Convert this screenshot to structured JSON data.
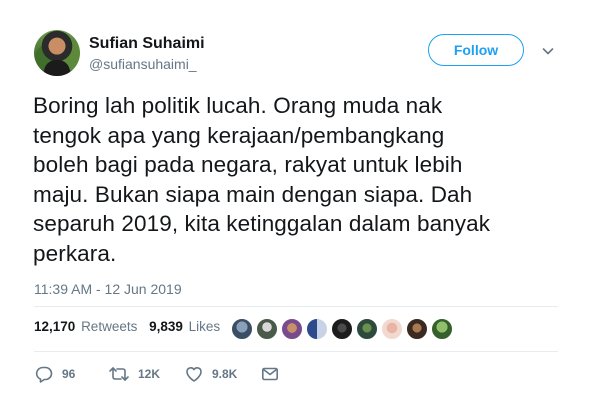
{
  "user": {
    "name": "Sufian Suhaimi",
    "handle": "@sufiansuhaimi_",
    "follow_label": "Follow"
  },
  "tweet": {
    "lines": [
      "Boring lah politik lucah. Orang muda nak",
      "tengok apa yang kerajaan/pembangkang",
      "boleh bagi pada negara, rakyat untuk lebih",
      "maju. Bukan siapa main dengan siapa. Dah",
      "separuh 2019, kita ketinggalan dalam banyak",
      "perkara."
    ],
    "timestamp": "11:39 AM - 12 Jun 2019"
  },
  "stats": {
    "retweets_count": "12,170",
    "retweets_label": "Retweets",
    "likes_count": "9,839",
    "likes_label": "Likes"
  },
  "actions": {
    "reply_count": "96",
    "retweet_count": "12K",
    "like_count": "9.8K"
  },
  "colors": {
    "accent": "#1da1f2",
    "muted": "#657786",
    "text": "#14171a",
    "divider": "#e6ecf0"
  },
  "icons": [
    "caret-down-icon",
    "reply-icon",
    "retweet-icon",
    "like-icon",
    "message-icon"
  ]
}
